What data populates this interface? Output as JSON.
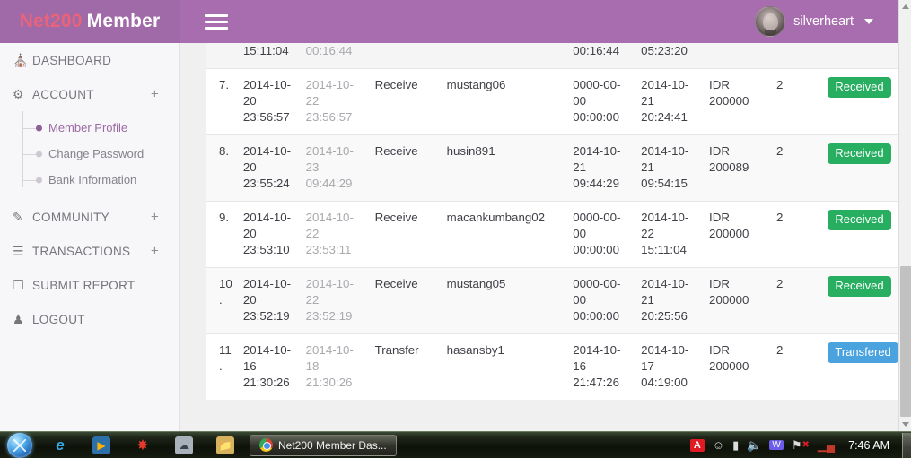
{
  "brand": {
    "primary": "Net200",
    "secondary": "Member",
    "primary_color": "#e9637a"
  },
  "header": {
    "menu_icon": "hamburger-icon",
    "username": "silverheart",
    "caret_icon": "chevron-down-icon"
  },
  "sidebar": {
    "items": [
      {
        "label": "DASHBOARD",
        "icon": "home-icon",
        "glyph": "⌂",
        "expandable": false
      },
      {
        "label": "ACCOUNT",
        "icon": "gear-icon",
        "glyph": "⚙",
        "expandable": true,
        "expand_label": "+"
      },
      {
        "label": "COMMUNITY",
        "icon": "edit-square-icon",
        "glyph": "✎",
        "expandable": true,
        "expand_label": "+"
      },
      {
        "label": "TRANSACTIONS",
        "icon": "list-rows-icon",
        "glyph": "☰",
        "expandable": true,
        "expand_label": "+"
      },
      {
        "label": "SUBMIT REPORT",
        "icon": "document-copy-icon",
        "glyph": "❐",
        "expandable": false
      },
      {
        "label": "LOGOUT",
        "icon": "users-group-icon",
        "glyph": "♟",
        "expandable": false
      }
    ],
    "account_submenu": [
      {
        "label": "Member Profile",
        "active": true
      },
      {
        "label": "Change Password",
        "active": false
      },
      {
        "label": "Bank Information",
        "active": false
      }
    ]
  },
  "table": {
    "partial_top_row": {
      "date1_last_line": "15:11:04",
      "date2_last_line": "00:16:44",
      "date3_last_line": "00:16:44",
      "date4_last_line": "05:23:20"
    },
    "rows": [
      {
        "num": "7.",
        "date1": "2014-10-20 23:56:57",
        "date2": "2014-10-22 23:56:57",
        "type": "Receive",
        "user": "mustang06",
        "date3": "0000-00-00 00:00:00",
        "date4": "2014-10-21 20:24:41",
        "amount": "IDR 200000",
        "qty": "2",
        "status": "Received",
        "status_kind": "received"
      },
      {
        "num": "8.",
        "date1": "2014-10-20 23:55:24",
        "date2": "2014-10-23 09:44:29",
        "type": "Receive",
        "user": "husin891",
        "date3": "2014-10-21 09:44:29",
        "date4": "2014-10-21 09:54:15",
        "amount": "IDR 200089",
        "qty": "2",
        "status": "Received",
        "status_kind": "received"
      },
      {
        "num": "9.",
        "date1": "2014-10-20 23:53:10",
        "date2": "2014-10-22 23:53:11",
        "type": "Receive",
        "user": "macankumbang02",
        "date3": "0000-00-00 00:00:00",
        "date4": "2014-10-22 15:11:04",
        "amount": "IDR 200000",
        "qty": "2",
        "status": "Received",
        "status_kind": "received"
      },
      {
        "num": "10.",
        "date1": "2014-10-20 23:52:19",
        "date2": "2014-10-22 23:52:19",
        "type": "Receive",
        "user": "mustang05",
        "date3": "0000-00-00 00:00:00",
        "date4": "2014-10-21 20:25:56",
        "amount": "IDR 200000",
        "qty": "2",
        "status": "Received",
        "status_kind": "received"
      },
      {
        "num": "11.",
        "date1": "2014-10-16 21:30:26",
        "date2": "2014-10-18 21:30:26",
        "type": "Transfer",
        "user": "hasansby1",
        "date3": "2014-10-16 21:47:26",
        "date4": "2014-10-17 04:19:00",
        "amount": "IDR 200000",
        "qty": "2",
        "status": "Transfered",
        "status_kind": "transfered"
      }
    ],
    "badge_colors": {
      "received": "#27ae60",
      "transfered": "#4aa3df"
    }
  },
  "scrollbar": {
    "up_icon": "scroll-up-arrow",
    "down_icon": "scroll-down-arrow"
  },
  "taskbar": {
    "start_label": "start-orb",
    "quick_launch": [
      {
        "name": "internet-explorer-icon",
        "glyph": "e"
      },
      {
        "name": "media-player-icon",
        "glyph": "▶"
      },
      {
        "name": "app-red-icon",
        "glyph": "✸"
      },
      {
        "name": "app-gray-icon",
        "glyph": "☁"
      },
      {
        "name": "file-explorer-icon",
        "glyph": "🖿"
      }
    ],
    "window_button": {
      "title": "Net200 Member Das...",
      "icon": "chrome-icon"
    },
    "tray": [
      {
        "name": "avira-icon",
        "glyph": "A"
      },
      {
        "name": "smiley-icon",
        "glyph": "☺"
      },
      {
        "name": "battery-icon",
        "glyph": "▀"
      },
      {
        "name": "volume-icon",
        "glyph": "◀"
      },
      {
        "name": "app-tray-icon",
        "glyph": "ᵂ"
      },
      {
        "name": "network-error-icon",
        "glyph": "⚑"
      },
      {
        "name": "signal-icon",
        "glyph": "▂"
      }
    ],
    "clock": "7:46 AM",
    "show_desktop": "show-desktop-button"
  }
}
